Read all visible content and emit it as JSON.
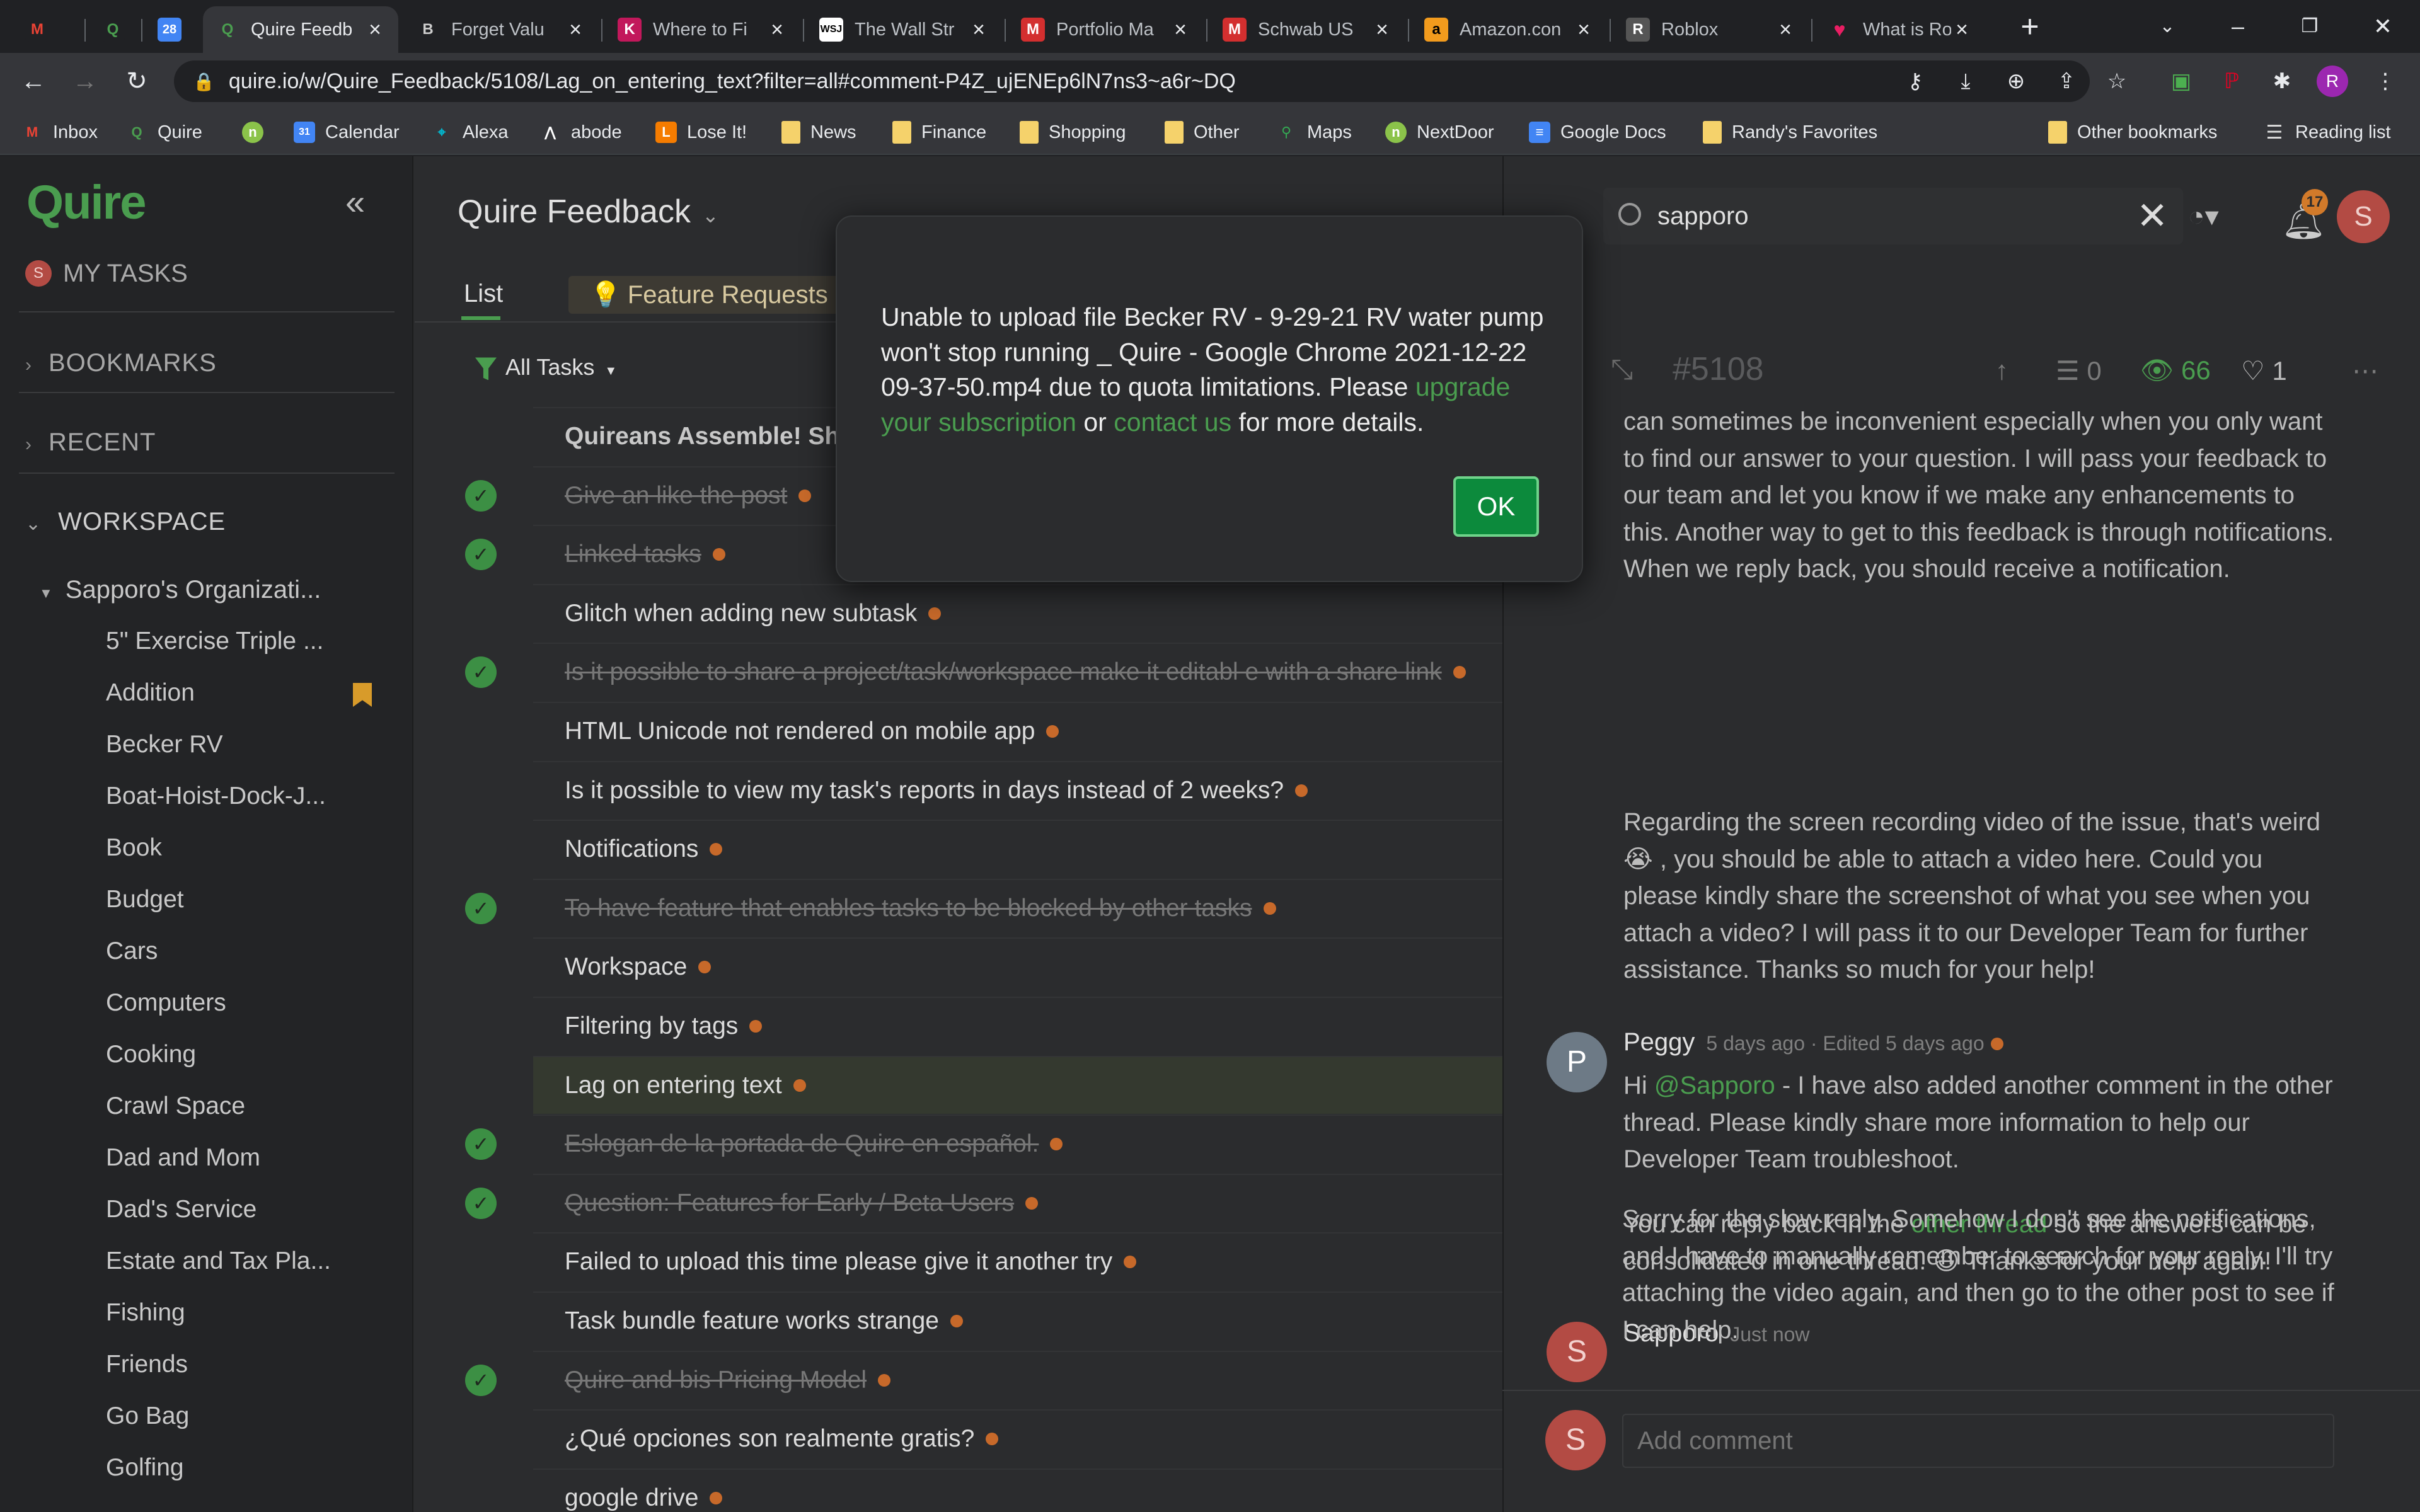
{
  "browser": {
    "tabs": [
      {
        "title": "",
        "icon": "gmail-icon",
        "color": "#202124",
        "glyph": "M"
      },
      {
        "title": "",
        "icon": "quire-icon",
        "color": "#202124",
        "glyph": "Q"
      },
      {
        "title": "",
        "icon": "calendar-icon",
        "color": "#4285f4",
        "glyph": "28"
      },
      {
        "title": "Quire Feedb",
        "icon": "quire-icon",
        "color": "#202124",
        "glyph": "Q"
      },
      {
        "title": "Forget Valu",
        "icon": "b-icon",
        "color": "#202124",
        "glyph": "B"
      },
      {
        "title": "Where to Fi",
        "icon": "k-icon",
        "color": "#c2185b",
        "glyph": "K"
      },
      {
        "title": "The Wall Str",
        "icon": "wsj-icon",
        "color": "#ffffff",
        "glyph": "WSJ"
      },
      {
        "title": "Portfolio Ma",
        "icon": "m-icon",
        "color": "#d32f2f",
        "glyph": "M"
      },
      {
        "title": "Schwab US",
        "icon": "m-icon",
        "color": "#d32f2f",
        "glyph": "M"
      },
      {
        "title": "Amazon.con",
        "icon": "amazon-icon",
        "color": "#f29b1d",
        "glyph": "a"
      },
      {
        "title": "Roblox",
        "icon": "roblox-icon",
        "color": "#555555",
        "glyph": "R"
      },
      {
        "title": "What is Rob",
        "icon": "heart-icon",
        "color": "#e91e63",
        "glyph": "♥"
      }
    ],
    "url": "quire.io/w/Quire_Feedback/5108/Lag_on_entering_text?filter=all#comment-P4Z_ujENEp6lN7ns3~a6r~DQ",
    "profile_initial": "R",
    "bookmarks": [
      {
        "label": "Inbox",
        "icon": "gmail-icon"
      },
      {
        "label": "Quire",
        "icon": "quire-icon"
      },
      {
        "label": "",
        "icon": "nextdoor-icon"
      },
      {
        "label": "Calendar",
        "icon": "calendar-icon"
      },
      {
        "label": "Alexa",
        "icon": "location-icon"
      },
      {
        "label": "abode",
        "icon": "abode-icon"
      },
      {
        "label": "Lose It!",
        "icon": "loseit-icon"
      },
      {
        "label": "News",
        "icon": "folder-icon"
      },
      {
        "label": "Finance",
        "icon": "folder-icon"
      },
      {
        "label": "Shopping",
        "icon": "folder-icon"
      },
      {
        "label": "Other",
        "icon": "folder-icon"
      },
      {
        "label": "Maps",
        "icon": "maps-icon"
      },
      {
        "label": "NextDoor",
        "icon": "nextdoor-icon"
      },
      {
        "label": "Google Docs",
        "icon": "docs-icon"
      },
      {
        "label": "Randy's Favorites",
        "icon": "folder-icon"
      },
      {
        "label": "Other bookmarks",
        "icon": "folder-icon"
      },
      {
        "label": "Reading list",
        "icon": "reading-list-icon"
      }
    ]
  },
  "sidebar": {
    "logo": "Quire",
    "my_tasks": "MY TASKS",
    "my_tasks_avatar": "S",
    "bookmarks": "BOOKMARKS",
    "recent": "RECENT",
    "workspace": "WORKSPACE",
    "org": "Sapporo's Organizati...",
    "projects": [
      "5\" Exercise Triple ...",
      "Addition",
      "Becker RV",
      "Boat-Hoist-Dock-J...",
      "Book",
      "Budget",
      "Cars",
      "Computers",
      "Cooking",
      "Crawl Space",
      "Dad and Mom",
      "Dad's Service",
      "Estate and Tax Pla...",
      "Fishing",
      "Friends",
      "Go Bag",
      "Golfing"
    ]
  },
  "main": {
    "project_title": "Quire Feedback",
    "tab_list": "List",
    "tab_feature": "Feature Requests",
    "filter": "All Tasks",
    "tasks": [
      {
        "title": "Quireans Assemble! Sh",
        "done": false,
        "bold": true
      },
      {
        "title": "Give an like the post",
        "done": true
      },
      {
        "title": "Linked tasks",
        "done": true
      },
      {
        "title": "Glitch when adding new subtask",
        "done": false
      },
      {
        "title": "Is it possible to share a project/task/workspace make it editabl e with a share link",
        "done": true
      },
      {
        "title": "HTML Unicode not rendered on mobile app",
        "done": false
      },
      {
        "title": "Is it possible to view my task's reports in days instead of 2 weeks?",
        "done": false
      },
      {
        "title": "Notifications",
        "done": false
      },
      {
        "title": "To have feature that enables tasks to be blocked by other tasks",
        "done": true
      },
      {
        "title": "Workspace",
        "done": false
      },
      {
        "title": "Filtering by tags",
        "done": false
      },
      {
        "title": "Lag on entering text",
        "done": false,
        "selected": true
      },
      {
        "title": "Eslogan de la portada de Quire en español.",
        "done": true
      },
      {
        "title": "Question: Features for Early / Beta Users",
        "done": true
      },
      {
        "title": "Failed to upload this time please give it another try",
        "done": false
      },
      {
        "title": "Task bundle feature works strange",
        "done": false
      },
      {
        "title": "Quire and bis Pricing Model",
        "done": true
      },
      {
        "title": "¿Qué opciones son realmente gratis?",
        "done": false
      },
      {
        "title": "google drive",
        "done": false
      }
    ]
  },
  "detail": {
    "search_value": "sapporo",
    "notif_count": "17",
    "user_initial": "S",
    "ticket_id": "#5108",
    "subtask_count": "0",
    "views": "66",
    "likes": "1",
    "comment1_p1": "can sometimes be inconvenient especially when you only want to find our answer to your question. I will pass your feedback to our team and let you know if we make any enhancements to this. Another way to get to this feedback is through notifications. When we reply back, you should receive a notification.",
    "comment1_p2": "Regarding the screen recording video of the issue, that's weird 😭 , you should be able to attach a video here. Could you please kindly share the screenshot of what you see when you attach a video? I will pass it to our Developer Team for further assistance. Thanks so much for your help!",
    "peggy_name": "Peggy",
    "peggy_meta": "5 days ago · Edited 5 days ago",
    "peggy_p1_a": "Hi ",
    "peggy_mention": "@Sapporo",
    "peggy_p1_b": "  - I have also added another comment in the other thread. Please kindly share more information to help our Developer Team troubleshoot.",
    "peggy_p2_a": "You can reply back in the ",
    "peggy_link": "other thread",
    "peggy_p2_b": " so the answers can be consolidated in one thread. 😃 Thanks for your help again!",
    "sapporo_name": "Sapporo",
    "sapporo_meta": "Just now",
    "sapporo_p1": "Sorry for the slow reply. Somehow I don't see the notifications, and I have to manually remember to search for your reply. I'll try attaching the video again, and then go to the other post to see if I can help.",
    "add_comment_placeholder": "Add comment"
  },
  "modal": {
    "msg_a": "Unable to upload file Becker RV - 9-29-21 RV water pump won't stop running _ Quire - Google Chrome 2021-12-22 09-37-50.mp4 due to quota limitations. Please ",
    "link_upgrade": "upgrade your subscription",
    "msg_b": " or ",
    "link_contact": "contact us",
    "msg_c": " for more details.",
    "ok": "OK"
  }
}
